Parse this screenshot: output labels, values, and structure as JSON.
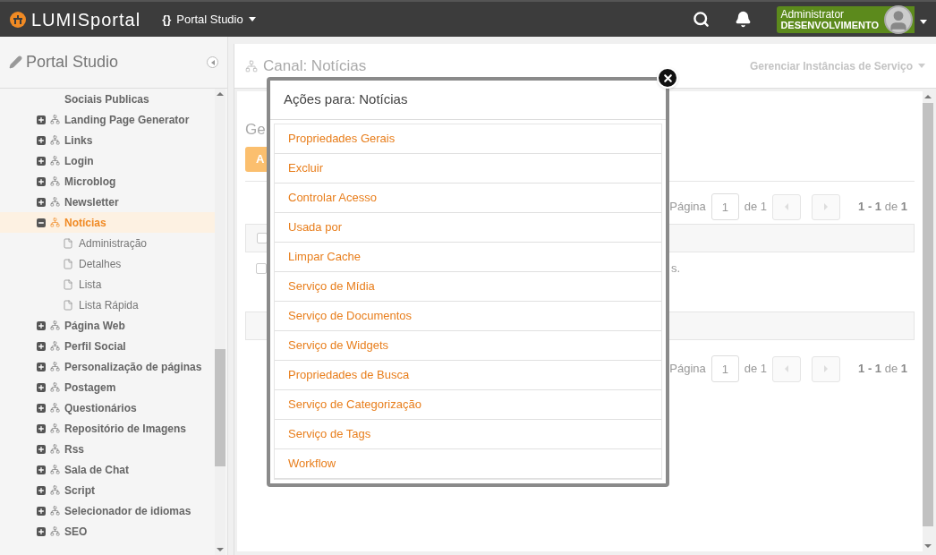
{
  "topbar": {
    "logo": "LUMISportal",
    "braces": "{}",
    "app_menu": "Portal Studio",
    "user": {
      "name": "Administrator",
      "role": "DESENVOLVIMENTO"
    }
  },
  "sidebar": {
    "title": "Portal Studio",
    "tree": [
      {
        "kind": "label",
        "label": "Sociais Publicas",
        "selected": false
      },
      {
        "kind": "node",
        "label": "Landing Page Generator",
        "expanded": false,
        "selected": false
      },
      {
        "kind": "node",
        "label": "Links",
        "expanded": false,
        "selected": false
      },
      {
        "kind": "node",
        "label": "Login",
        "expanded": false,
        "selected": false
      },
      {
        "kind": "node",
        "label": "Microblog",
        "expanded": false,
        "selected": false
      },
      {
        "kind": "node",
        "label": "Newsletter",
        "expanded": false,
        "selected": false
      },
      {
        "kind": "node",
        "label": "Notícias",
        "expanded": true,
        "selected": true,
        "children": [
          {
            "kind": "page",
            "label": "Administração",
            "selected": false
          },
          {
            "kind": "page",
            "label": "Detalhes",
            "selected": false
          },
          {
            "kind": "page",
            "label": "Lista",
            "selected": false
          },
          {
            "kind": "page",
            "label": "Lista Rápida",
            "selected": false
          }
        ]
      },
      {
        "kind": "node",
        "label": "Página Web",
        "expanded": false,
        "selected": false
      },
      {
        "kind": "node",
        "label": "Perfil Social",
        "expanded": false,
        "selected": false
      },
      {
        "kind": "node",
        "label": "Personalização de páginas",
        "expanded": false,
        "selected": false
      },
      {
        "kind": "node",
        "label": "Postagem",
        "expanded": false,
        "selected": false
      },
      {
        "kind": "node",
        "label": "Questionários",
        "expanded": false,
        "selected": false
      },
      {
        "kind": "node",
        "label": "Repositório de Imagens",
        "expanded": false,
        "selected": false
      },
      {
        "kind": "node",
        "label": "Rss",
        "expanded": false,
        "selected": false
      },
      {
        "kind": "node",
        "label": "Sala de Chat",
        "expanded": false,
        "selected": false
      },
      {
        "kind": "node",
        "label": "Script",
        "expanded": false,
        "selected": false
      },
      {
        "kind": "node",
        "label": "Selecionador de idiomas",
        "expanded": false,
        "selected": false
      },
      {
        "kind": "node",
        "label": "SEO",
        "expanded": false,
        "selected": false
      }
    ]
  },
  "main": {
    "title": "Canal: Notícias",
    "manage_menu": "Gerenciar Instâncias de Serviço",
    "heading_fragment": "Ge",
    "button_fragment": "A",
    "message_fragment": "s.",
    "select_all_checked": false,
    "row_checked": false,
    "pagers": [
      {
        "label": "Página",
        "page": "1",
        "of": "de 1",
        "summary": "**1 - 1** de **1**"
      },
      {
        "label": "Página",
        "page": "1",
        "of": "de 1",
        "summary": "**1 - 1** de **1**"
      }
    ]
  },
  "dialog": {
    "title": "Ações para: Notícias",
    "actions": [
      "Propriedades Gerais",
      "Excluir",
      "Controlar Acesso",
      "Usada por",
      "Limpar Cache",
      "Serviço de Mídia",
      "Serviço de Documentos",
      "Serviço de Widgets",
      "Propriedades de Busca",
      "Serviço de Categorização",
      "Serviço de Tags",
      "Workflow"
    ]
  }
}
